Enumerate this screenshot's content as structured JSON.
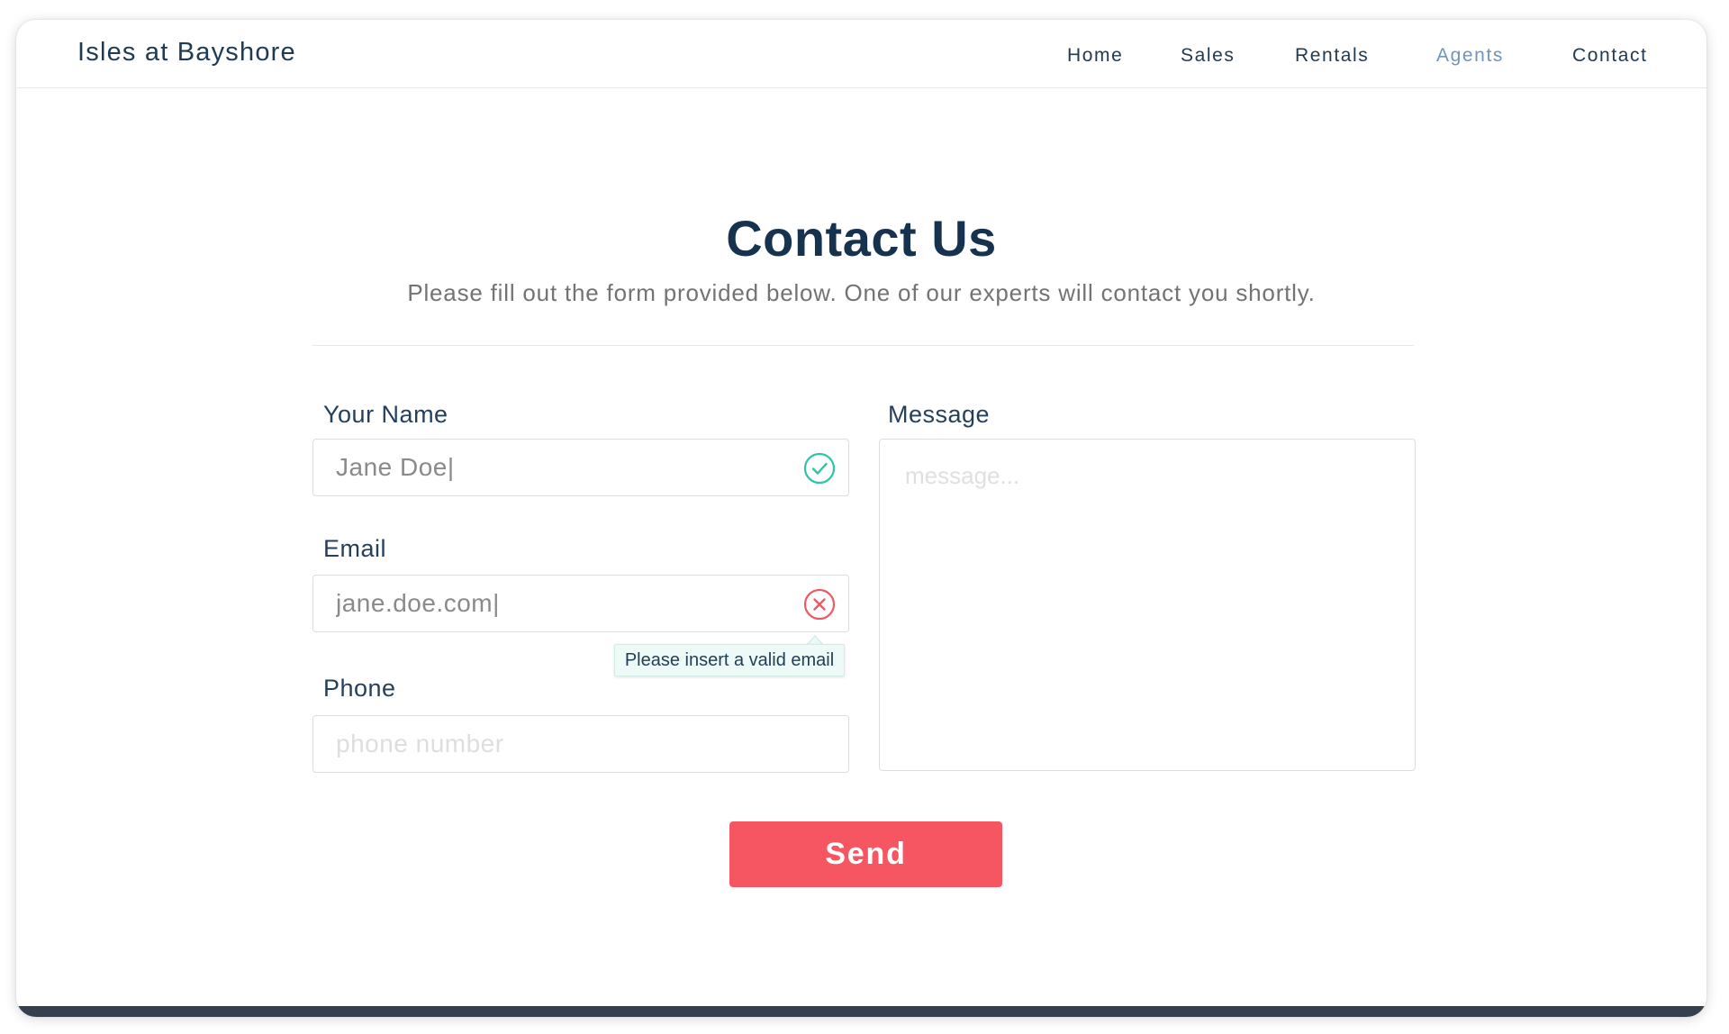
{
  "header": {
    "brand": "Isles at Bayshore",
    "nav": [
      {
        "label": "Home"
      },
      {
        "label": "Sales"
      },
      {
        "label": "Rentals"
      },
      {
        "label": "Agents"
      },
      {
        "label": "Contact"
      }
    ],
    "active_item": "Agents"
  },
  "main": {
    "title": "Contact Us",
    "subtitle": "Please fill out the form provided below. One of our experts will contact you shortly."
  },
  "form": {
    "name": {
      "label": "Your Name",
      "value": "Jane Doe|",
      "status": "valid",
      "status_icon": "check-circle-icon"
    },
    "email": {
      "label": "Email",
      "value": "jane.doe.com|",
      "status": "invalid",
      "status_icon": "x-circle-icon",
      "error": "Please insert a valid email"
    },
    "phone": {
      "label": "Phone",
      "placeholder": "phone number",
      "value": ""
    },
    "message": {
      "label": "Message",
      "placeholder": "message...",
      "value": ""
    },
    "send_label": "Send"
  },
  "colors": {
    "accent": "#f65661",
    "valid": "#2ec4a6",
    "invalid": "#ee5a64",
    "heading": "#16324e",
    "nav_active": "#6e95bd",
    "footer": "#34404d"
  }
}
